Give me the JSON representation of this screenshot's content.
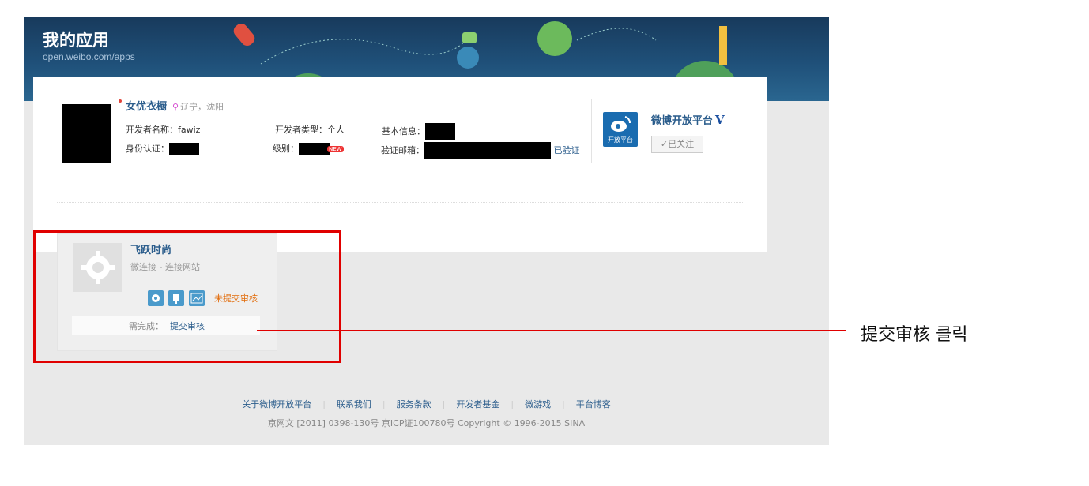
{
  "banner": {
    "title": "我的应用",
    "url": "open.weibo.com/apps"
  },
  "developer": {
    "name": "女优衣橱",
    "location": "辽宁，沈阳",
    "dev_name_label": "开发者名称：fawiz",
    "dev_type_label": "开发者类型：个人",
    "basic_info_label": "基本信息：",
    "id_label": "身份认证：",
    "level_label": "级别：",
    "new_badge": "NEW",
    "email_label": "验证邮箱：",
    "verified": "已验证"
  },
  "platform": {
    "name": "微博开放平台",
    "v_mark": "V",
    "logo_label": "开放平台",
    "follow_button": "✓已关注"
  },
  "app": {
    "title": "飞跃时尚",
    "subtitle": "微连接 - 连接网站",
    "status": "未提交审核",
    "need_label": "需完成：",
    "need_link": "提交审核",
    "tools": [
      "gear-icon",
      "plug-icon",
      "chart-icon"
    ]
  },
  "footer": {
    "links": [
      "关于微博开放平台",
      "联系我们",
      "服务条款",
      "开发者基金",
      "微游戏",
      "平台博客"
    ],
    "copyright": "京网文 [2011] 0398-130号    京ICP证100780号    Copyright © 1996-2015 SINA"
  },
  "annotation": {
    "text": "提交审核 클릭",
    "color": "#e00000"
  }
}
